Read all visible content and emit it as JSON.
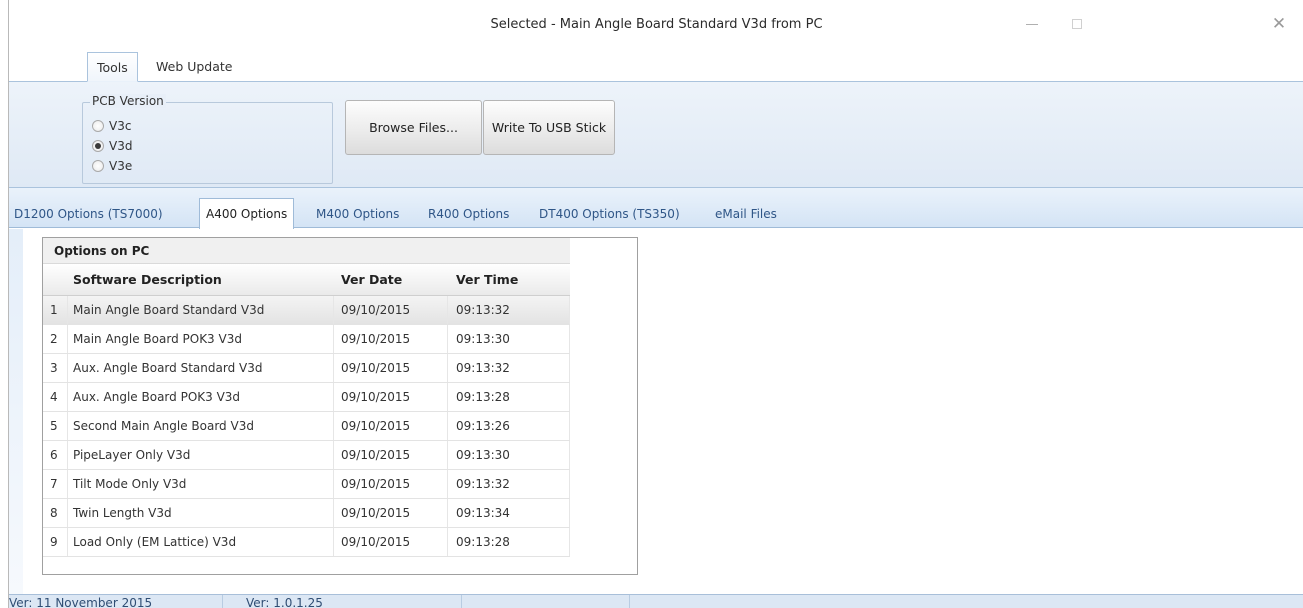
{
  "window": {
    "title": "Selected - Main Angle Board Standard V3d from PC",
    "controls": {
      "minimize": "minimize-icon",
      "maximize": "maximize-icon",
      "close": "close-icon"
    }
  },
  "ribbon": {
    "tabs": [
      {
        "label": "Tools"
      },
      {
        "label": "Web Update"
      }
    ],
    "active_tab": "Tools",
    "pcb_version": {
      "title": "PCB Version",
      "options": [
        {
          "label": "V3c",
          "checked": false
        },
        {
          "label": "V3d",
          "checked": true
        },
        {
          "label": "V3e",
          "checked": false
        }
      ]
    },
    "buttons": {
      "browse": "Browse Files...",
      "write_usb": "Write To USB Stick"
    }
  },
  "option_tabs": [
    {
      "label": "D1200 Options (TS7000)"
    },
    {
      "label": "A400 Options"
    },
    {
      "label": "M400 Options"
    },
    {
      "label": "R400 Options"
    },
    {
      "label": "DT400 Options (TS350)"
    },
    {
      "label": "eMail Files"
    }
  ],
  "active_option_tab": "A400 Options",
  "grid": {
    "caption": "Options on PC",
    "columns": [
      "Software Description",
      "Ver Date",
      "Ver Time"
    ],
    "rows": [
      {
        "idx": "1",
        "desc": "Main Angle Board Standard V3d",
        "date": "09/10/2015",
        "time": "09:13:32",
        "selected": true
      },
      {
        "idx": "2",
        "desc": "Main Angle Board POK3 V3d",
        "date": "09/10/2015",
        "time": "09:13:30"
      },
      {
        "idx": "3",
        "desc": "Aux. Angle Board Standard V3d",
        "date": "09/10/2015",
        "time": "09:13:32"
      },
      {
        "idx": "4",
        "desc": "Aux. Angle Board POK3 V3d",
        "date": "09/10/2015",
        "time": "09:13:28"
      },
      {
        "idx": "5",
        "desc": "Second Main Angle Board V3d",
        "date": "09/10/2015",
        "time": "09:13:26"
      },
      {
        "idx": "6",
        "desc": "PipeLayer Only V3d",
        "date": "09/10/2015",
        "time": "09:13:30"
      },
      {
        "idx": "7",
        "desc": "Tilt Mode Only V3d",
        "date": "09/10/2015",
        "time": "09:13:32"
      },
      {
        "idx": "8",
        "desc": "Twin Length V3d",
        "date": "09/10/2015",
        "time": "09:13:34"
      },
      {
        "idx": "9",
        "desc": "Load Only (EM Lattice) V3d",
        "date": "09/10/2015",
        "time": "09:13:28"
      }
    ]
  },
  "status": {
    "version_date": "Ver: 11 November 2015",
    "version_number": "Ver: 1.0.1.25"
  }
}
